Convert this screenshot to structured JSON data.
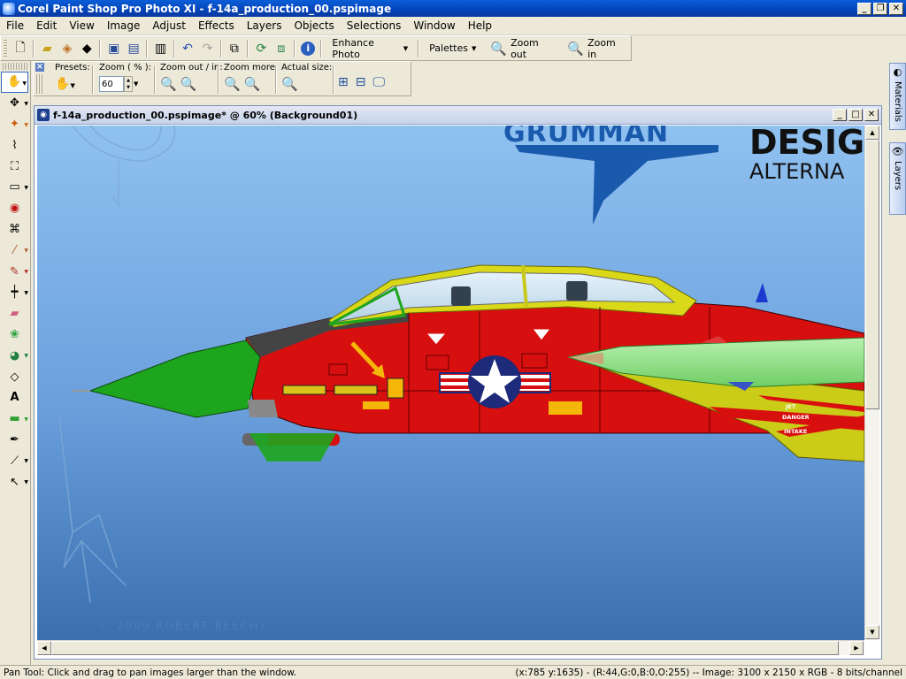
{
  "app": {
    "title": "Corel Paint Shop Pro Photo XI - f-14a_production_00.pspimage"
  },
  "menu": {
    "items": [
      "File",
      "Edit",
      "View",
      "Image",
      "Adjust",
      "Effects",
      "Layers",
      "Objects",
      "Selections",
      "Window",
      "Help"
    ]
  },
  "toolbar": {
    "enhance_photo": "Enhance Photo",
    "palettes": "Palettes",
    "zoom_out": "Zoom out",
    "zoom_in": "Zoom in"
  },
  "tool_options": {
    "presets_label": "Presets:",
    "zoom_label": "Zoom ( % ):",
    "zoom_value": "60",
    "zoom_out_in_label": "Zoom out / in:",
    "zoom_more_label": "Zoom more:",
    "actual_size_label": "Actual size:"
  },
  "right_palettes": {
    "materials": "Materials",
    "layers": "Layers"
  },
  "document": {
    "title": "f-14a_production_00.pspimage* @  60% (Background01)",
    "canvas_text": {
      "brand": "GRUMMAN",
      "design_partial": "DESIG",
      "alternate_partial": "ALTERNA",
      "copyright": "© 2009 ROBERT BEECHY",
      "jet_label": "JET",
      "danger_label": "DANGER",
      "intake_label": "INTAKE"
    }
  },
  "status": {
    "hint": "Pan Tool: Click and drag to pan images larger than the window.",
    "info": "(x:785 y:1635) - (R:44,G:0,B:0,O:255) -- Image:  3100 x 2150 x RGB - 8 bits/channel"
  },
  "colors": {
    "title_blue": "#0544b8",
    "sky_top": "#8fc1f0",
    "sky_bottom": "#3a6fb0",
    "jet_red": "#d80f0f",
    "nose_green": "#1ea51e",
    "canopy_yellow": "#d9d91a",
    "grumman_blue": "#1a5aad"
  }
}
